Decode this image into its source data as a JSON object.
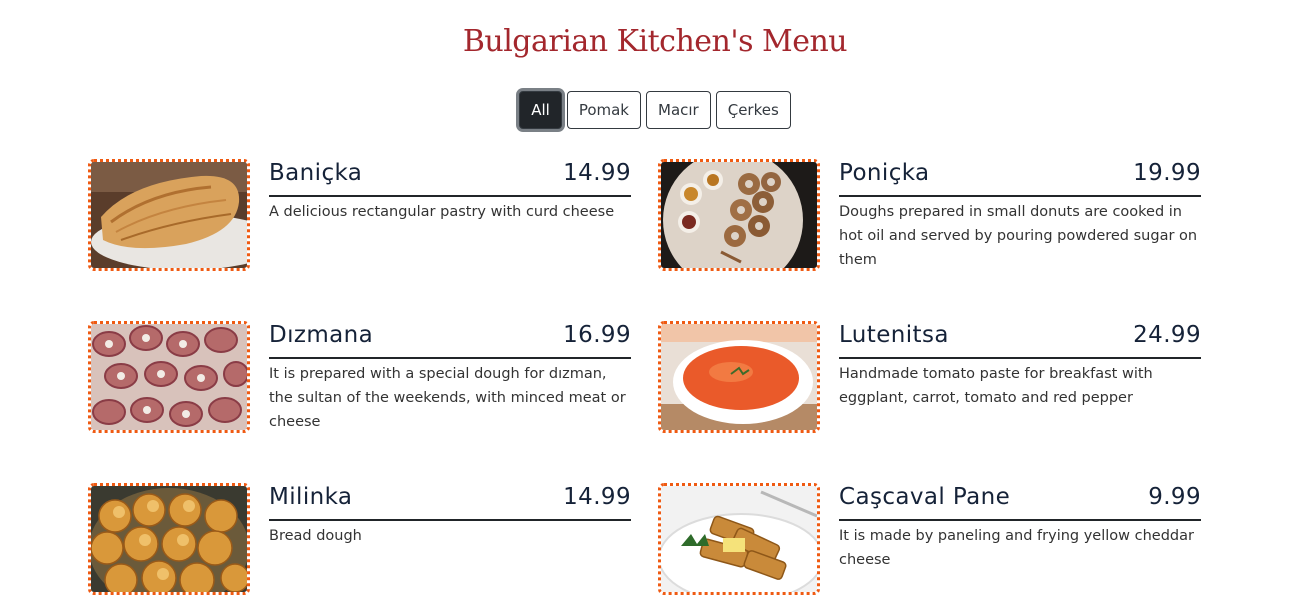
{
  "page": {
    "title": "Bulgarian Kitchen's Menu"
  },
  "filters": [
    {
      "label": "All",
      "active": true
    },
    {
      "label": "Pomak",
      "active": false
    },
    {
      "label": "Macır",
      "active": false
    },
    {
      "label": "Çerkes",
      "active": false
    }
  ],
  "menu": [
    {
      "name": "Baniçka",
      "price": "14.99",
      "description": "A delicious rectangular pastry with curd cheese",
      "image": "banicka-photo"
    },
    {
      "name": "Poniçka",
      "price": "19.99",
      "description": "Doughs prepared in small donuts are cooked in hot oil and served by pouring powdered sugar on them",
      "image": "ponicka-photo"
    },
    {
      "name": "Dızmana",
      "price": "16.99",
      "description": "It is prepared with a special dough for dızman, the sultan of the weekends, with minced meat or cheese",
      "image": "dizmana-photo"
    },
    {
      "name": "Lutenitsa",
      "price": "24.99",
      "description": "Handmade tomato paste for breakfast with eggplant, carrot, tomato and red pepper",
      "image": "lutenitsa-photo"
    },
    {
      "name": "Milinka",
      "price": "14.99",
      "description": "Bread dough",
      "image": "milinka-photo"
    },
    {
      "name": "Caşcaval Pane",
      "price": "9.99",
      "description": "It is made by paneling and frying yellow cheddar cheese",
      "image": "cascaval-pane-photo"
    }
  ],
  "colors": {
    "title": "#a3272d",
    "photo_border": "#ef5a12",
    "active_filter": "#212529"
  }
}
